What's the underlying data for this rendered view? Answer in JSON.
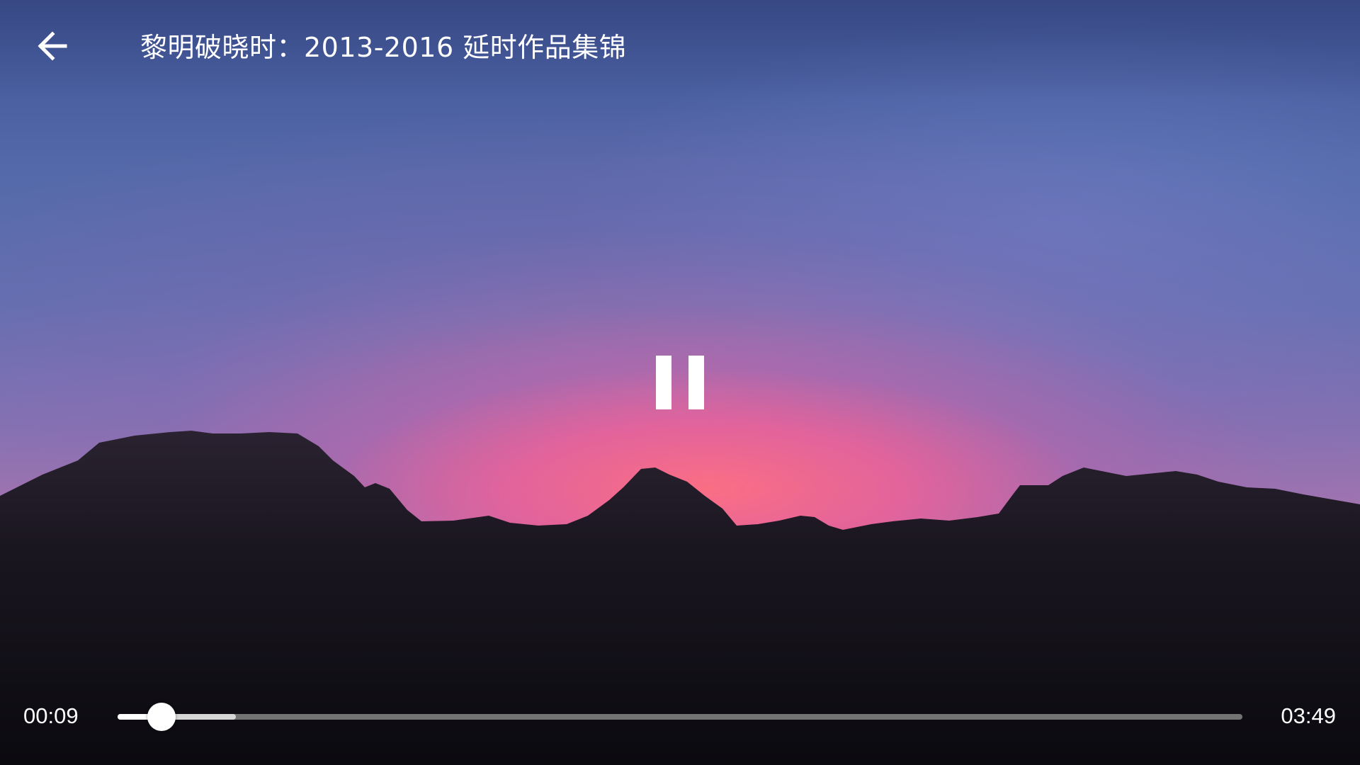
{
  "player": {
    "title": "黎明破晓时：2013-2016 延时作品集锦",
    "state": "playing",
    "current_time": "00:09",
    "total_time": "03:49",
    "progress_fraction": 0.039,
    "buffered_fraction": 0.105
  },
  "icons": {
    "back": "arrow-left-icon",
    "pause": "pause-icon"
  },
  "colors": {
    "controls": "#ffffff",
    "track": "#969696"
  }
}
